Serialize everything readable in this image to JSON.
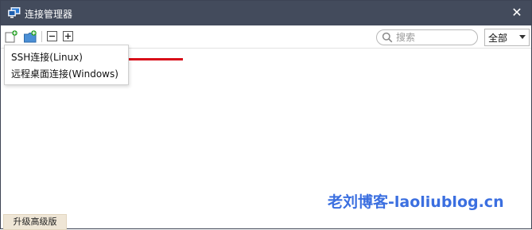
{
  "window": {
    "title": "连接管理器",
    "close_symbol": "✕"
  },
  "toolbar": {
    "icons": [
      "new-connection-icon",
      "new-folder-icon",
      "collapse-all-icon",
      "expand-all-icon"
    ],
    "search_placeholder": "搜索",
    "filter_value": "全部"
  },
  "menu": {
    "items": [
      {
        "label": "SSH连接(Linux)"
      },
      {
        "label": "远程桌面连接(Windows)"
      }
    ]
  },
  "footer": {
    "upgrade_label": "升级高级版"
  },
  "watermark": {
    "text": "老刘博客-laoliublog.cn"
  },
  "colors": {
    "titlebar": "#434b5c",
    "accent_red": "#d80c18",
    "watermark": "#3b6fe0",
    "upgrade_bg": "#efe6d6"
  }
}
